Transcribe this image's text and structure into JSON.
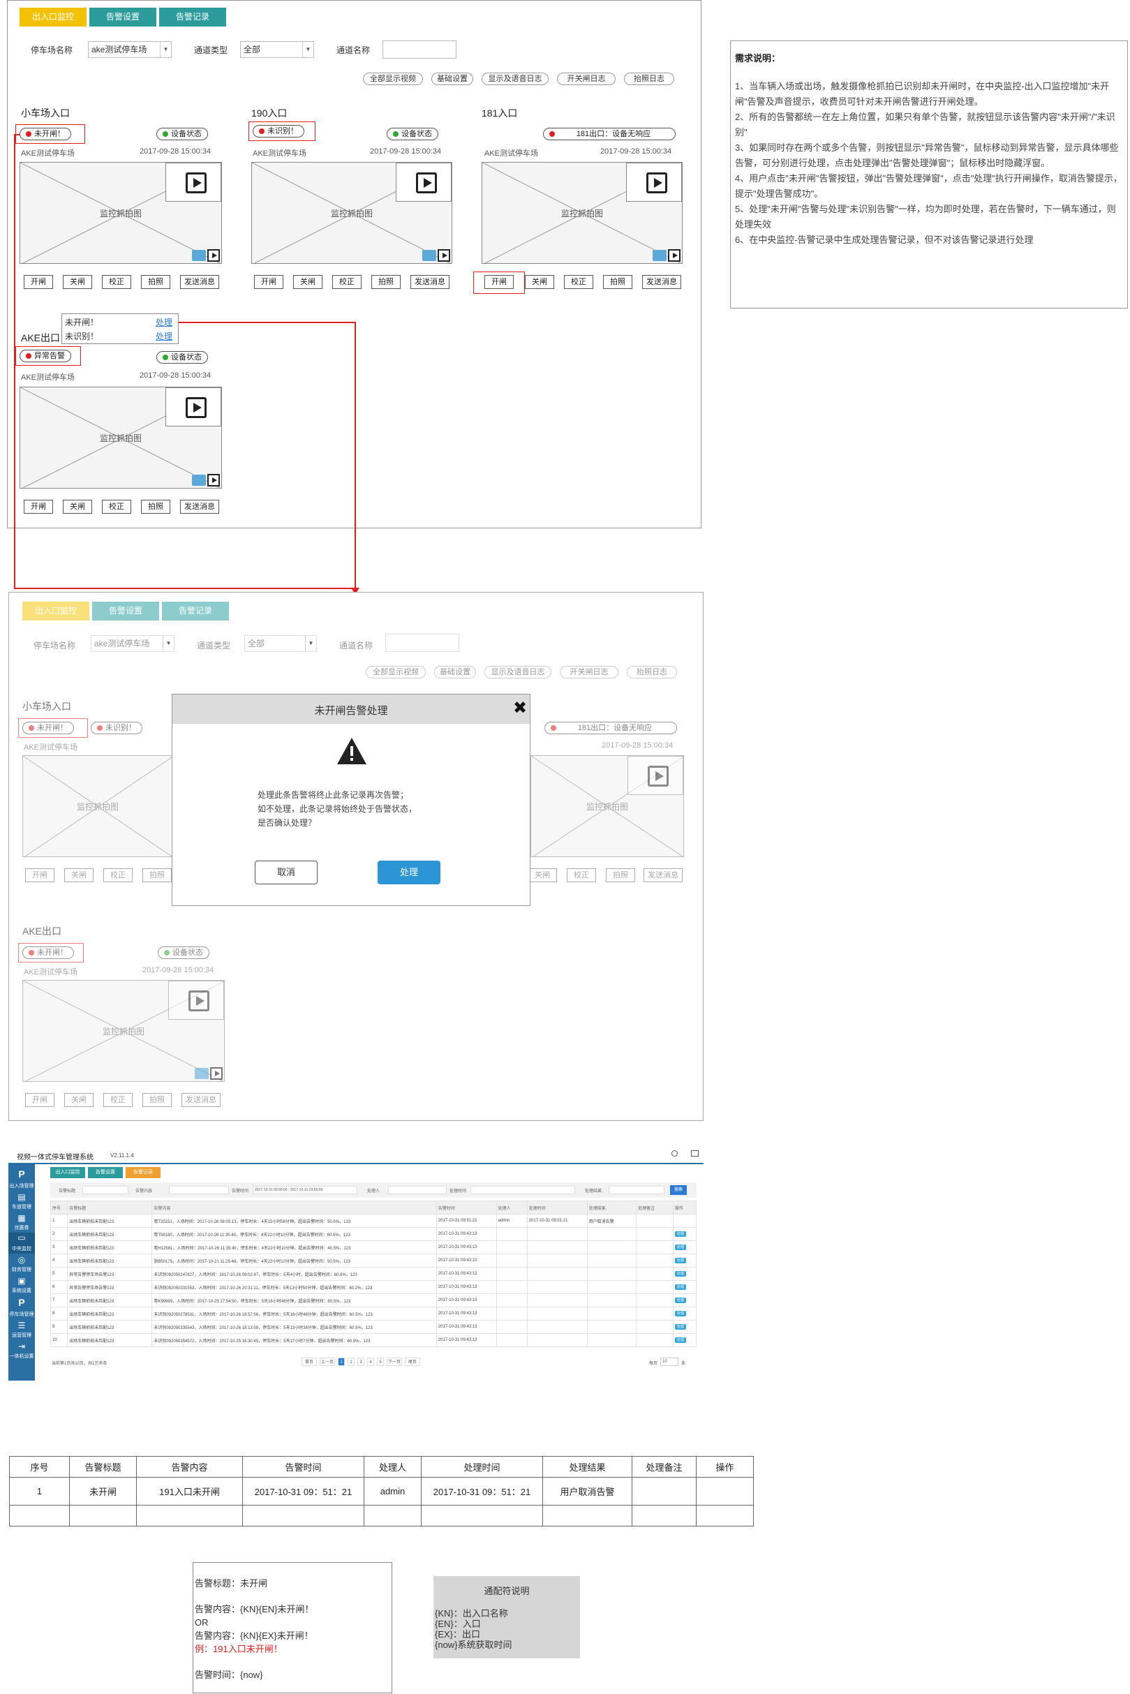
{
  "tabs": [
    "出入口监控",
    "告警设置",
    "告警记录"
  ],
  "filters": {
    "parking_label": "停车场名称",
    "parking_value": "ake测试停车场",
    "channel_type_label": "通道类型",
    "channel_type_value": "全部",
    "channel_name_label": "通道名称",
    "channel_name_value": ""
  },
  "toolbar": [
    "全部显示视频",
    "基础设置",
    "显示及语音日志",
    "开关闸日志",
    "抬照日志"
  ],
  "lanes": [
    {
      "title": "小车场入口",
      "alert": "未开闸！",
      "status": "设备状态",
      "park": "AKE测试停车场",
      "time": "2017-09-28 15:00:34",
      "image_caption": "监控抓拍图"
    },
    {
      "title": "190入口",
      "alert": "未识别！",
      "status": "设备状态",
      "park": "AKE测试停车场",
      "time": "2017-09-28 15:00:34",
      "image_caption": "监控抓拍图"
    },
    {
      "title": "181入口",
      "alert": "181出口：设备无响应",
      "park": "AKE测试停车场",
      "time": "2017-09-28 15:00:34",
      "image_caption": "监控抓拍图"
    },
    {
      "title": "AKE出口",
      "alert": "异常告警",
      "status": "设备状态",
      "park": "AKE测试停车场",
      "time": "2017-09-28 15:00:34",
      "image_caption": "监控抓拍图"
    }
  ],
  "lane_buttons": [
    "开闸",
    "关闸",
    "校正",
    "拍照",
    "发送消息"
  ],
  "popup": {
    "item1": "未开闸！",
    "item2": "未识别！",
    "action": "处理"
  },
  "requirements": {
    "title": "需求说明：",
    "lines": [
      "1、当车辆入场或出场，触发摄像枪抓拍已识别却未开闸时，在中央监控-出入口监控增加\"未开闸\"告警及声音提示，收费员可针对未开闸告警进行开闸处理。",
      "2、所有的告警都统一在左上角位置，如果只有单个告警，就按钮显示该告警内容\"未开闸\"/\"未识别\"",
      "3、如果同时存在两个或多个告警，则按钮显示\"异常告警\"，鼠标移动到异常告警，显示具体哪些告警，可分别进行处理，点击处理弹出\"告警处理弹窗\"；鼠标移出时隐藏浮窗。",
      "4、用户点击\"未开闸\"告警按钮，弹出\"告警处理弹窗\"，点击\"处理\"执行开闸操作，取消告警提示，提示\"处理告警成功\"。",
      "5、处理\"未开闸\"告警与处理\"未识别告警\"一样，均为即时处理，若在告警时，下一辆车通过，则处理失效",
      "6、在中央监控-告警记录中生成处理告警记录，但不对该告警记录进行处理"
    ]
  },
  "second": {
    "lane_alerts": [
      "未开闸！",
      "未识别！"
    ],
    "exit_alert": "未开闸！",
    "dialog": {
      "title": "未开闸告警处理",
      "message_lines": [
        "处理此条告警将终止此条记录再次告警；",
        "如不处理，此条记录将始终处于告警状态，",
        "是否确认处理？"
      ],
      "cancel": "取消",
      "confirm": "处理"
    }
  },
  "app": {
    "title": "视频一体式停车管理系统",
    "version": "V2.11.1.4",
    "sidebar": [
      "出入场管理",
      "车道管理",
      "优惠券",
      "中央监控",
      "财务管理",
      "系统设置",
      "停车场管理",
      "运营管理",
      "一体机设置"
    ],
    "tabs": [
      "出入口监控",
      "告警设置",
      "告警记录"
    ],
    "filters": {
      "title": "告警标题",
      "content": "告警内容",
      "time": "告警时间",
      "time_value": "2017-10-31 00:00:00 - 2017-10-31 23:59:59",
      "handler": "处理人",
      "handle_time": "处理时间",
      "result": "处理结果",
      "search": "搜索"
    },
    "columns": [
      "序号",
      "告警标题",
      "告警内容",
      "告警时间",
      "处理人",
      "处理时间",
      "处理结果",
      "处理备注",
      "操作"
    ],
    "rows": [
      [
        "1",
        "出场车辆抓拍未匹配123",
        "粤T25151，入场时间：2017-10-26 08:05:13，停车时长：4天15小时56分钟，超出告警时间：50.5%，123",
        "2017-10-31 09:51:21",
        "admin",
        "2017-10-31 09:51:21",
        "用户取消告警",
        "",
        ""
      ],
      [
        "2",
        "出场车辆抓拍未匹配123",
        "粤T56180，入场时间：2017-10-26 11:35:40，停车时长：4天22小时10分钟，超出告警时间：60.5%，123",
        "2017-10-31 09:43:13",
        "",
        "",
        "",
        "",
        "处理"
      ],
      [
        "3",
        "出场车辆抓拍未匹配123",
        "粤H12561，入场时间：2017-10-26 11:35:40，停车时长：4天22小时10分钟，超出告警时间：40.5%，123",
        "2017-10-31 09:43:13",
        "",
        "",
        "",
        "",
        "处理"
      ],
      [
        "4",
        "出场车辆抓拍未匹配123",
        "浙B50175，入场时间：2017-10-21 11:25:48，停车时长：4天22小时10分钟，超出告警时间：50.5%，123",
        "2017-10-31 09:43:13",
        "",
        "",
        "",
        "",
        "处理"
      ],
      [
        "5",
        "异常告警停车场告警123",
        "未识别092050247827，入场时间：2017-10-26 09:02:47，停车时长：5天4小时，超出告警时间：60.6%，123",
        "2017-10-31 09:43:13",
        "",
        "",
        "",
        "",
        "处理"
      ],
      [
        "6",
        "异常告警停车场告警123",
        "未识别092050331553，入场时间：2017-10-26 20:31:11，停车时长：5天13小时50分钟，超出告警时间：60.2%，123",
        "2017-10-31 09:43:13",
        "",
        "",
        "",
        "",
        "处理"
      ],
      [
        "7",
        "出场车辆抓拍未匹配123",
        "粤K99999，入场时间：2017-10-25 17:54:50，停车时长：5天16小时48分钟，超出告警时间：60.5%，123",
        "2017-10-31 09:43:13",
        "",
        "",
        "",
        "",
        "处理"
      ],
      [
        "8",
        "出场车辆抓拍未匹配123",
        "未识别092050278531，入场时间：2017-10-26 18:57:56，停车时长：5天16小时48分钟，超出告警时间：60.5%，123",
        "2017-10-31 09:43:13",
        "",
        "",
        "",
        "",
        "处理"
      ],
      [
        "9",
        "出场车辆抓拍未匹配123",
        "未识别092050335543，入场时间：2017-10-26 18:13:09，停车时长：5天13小时38分钟，超出告警时间：60.5%，123",
        "2017-10-31 09:43:13",
        "",
        "",
        "",
        "",
        "处理"
      ],
      [
        "10",
        "出场车辆抓拍未匹配123",
        "未识别092050354572，入场时间：2017-10-25 16:30:45，停车时长：5天17小时7分钟，超出告警时间：60.5%，123",
        "2017-10-31 09:43:13",
        "",
        "",
        "",
        "",
        "处理"
      ]
    ],
    "footer": "当前第1页共10页，共1万多条",
    "pager": [
      "首页",
      "上一页",
      "1",
      "2",
      "3",
      "4",
      "5",
      "下一页",
      "尾页"
    ],
    "per_page": "每页",
    "per_page_value": "10",
    "per_page_unit": "条"
  },
  "record_table": {
    "columns": [
      "序号",
      "告警标题",
      "告警内容",
      "告警时间",
      "处理人",
      "处理时间",
      "处理结果",
      "处理备注",
      "操作"
    ],
    "row": [
      "1",
      "未开闸",
      "191入口未开闸",
      "2017-10-31 09：51：21",
      "admin",
      "2017-10-31 09：51：21",
      "用户取消告警",
      "",
      ""
    ]
  },
  "template_box": {
    "title_line": "告警标题：未开闸",
    "content1": "告警内容：{KN}{EN}未开闸！",
    "or": "OR",
    "content2": "告警内容：{KN}{EX}未开闸！",
    "example": "例：191入口未开闸！",
    "time_line": "告警时间：{now}"
  },
  "wildcard": {
    "title": "通配符说明",
    "lines": [
      "{KN}：出入口名称",
      "{EN}：入口",
      "{EX}：出口",
      "{now}系统获取时间"
    ]
  },
  "colors": {
    "tab_active": "#f2c200",
    "tab": "#2b9b9b",
    "alert": "#e02020",
    "ok": "#2ea82e",
    "primary": "#2b95d6",
    "sidebar": "#2a6fa3"
  }
}
